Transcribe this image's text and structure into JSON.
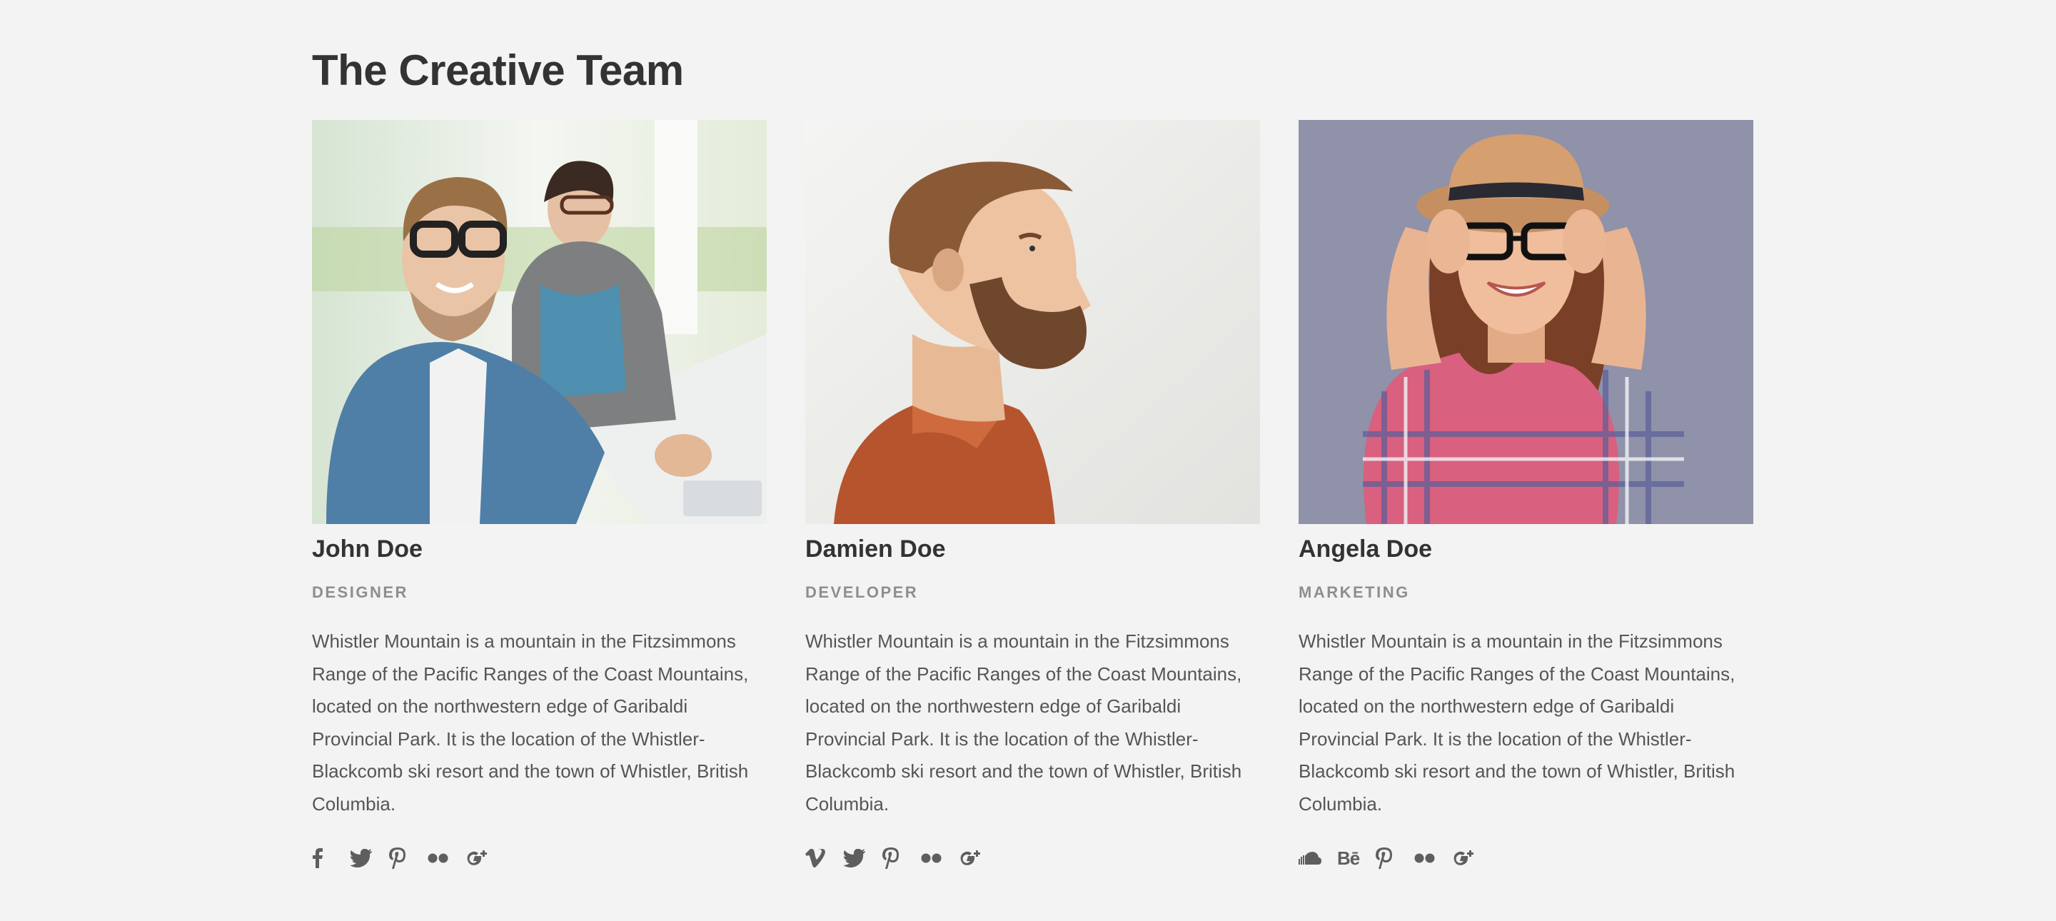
{
  "section": {
    "title": "The Creative Team"
  },
  "team": [
    {
      "name": "John Doe",
      "role": "DESIGNER",
      "bio": "Whistler Mountain is a mountain in the Fitzsimmons Range of the Pacific Ranges of the Coast Mountains, located on the northwestern edge of Garibaldi Provincial Park. It is the location of the Whistler-Blackcomb ski resort and the town of Whistler, British Columbia.",
      "photo_background": "#e8efe7",
      "social_icons": [
        "facebook-icon",
        "twitter-icon",
        "pinterest-icon",
        "flickr-icon",
        "google-plus-icon"
      ]
    },
    {
      "name": "Damien Doe",
      "role": "DEVELOPER",
      "bio": "Whistler Mountain is a mountain in the Fitzsimmons Range of the Pacific Ranges of the Coast Mountains, located on the northwestern edge of Garibaldi Provincial Park. It is the location of the Whistler-Blackcomb ski resort and the town of Whistler, British Columbia.",
      "photo_background": "#eeeeec",
      "social_icons": [
        "vimeo-icon",
        "twitter-icon",
        "pinterest-icon",
        "flickr-icon",
        "google-plus-icon"
      ]
    },
    {
      "name": "Angela Doe",
      "role": "MARKETING",
      "bio": "Whistler Mountain is a mountain in the Fitzsimmons Range of the Pacific Ranges of the Coast Mountains, located on the northwestern edge of Garibaldi Provincial Park. It is the location of the Whistler-Blackcomb ski resort and the town of Whistler, British Columbia.",
      "photo_background": "#8f92a8",
      "social_icons": [
        "soundcloud-icon",
        "behance-icon",
        "pinterest-icon",
        "flickr-icon",
        "google-plus-icon"
      ]
    }
  ],
  "social_labels": {
    "behance": "Bē"
  },
  "colors": {
    "page_background": "#f3f3f3",
    "heading": "#333333",
    "role": "#8e8e8e",
    "body_text": "#555555",
    "icon": "#5e5e5e"
  }
}
